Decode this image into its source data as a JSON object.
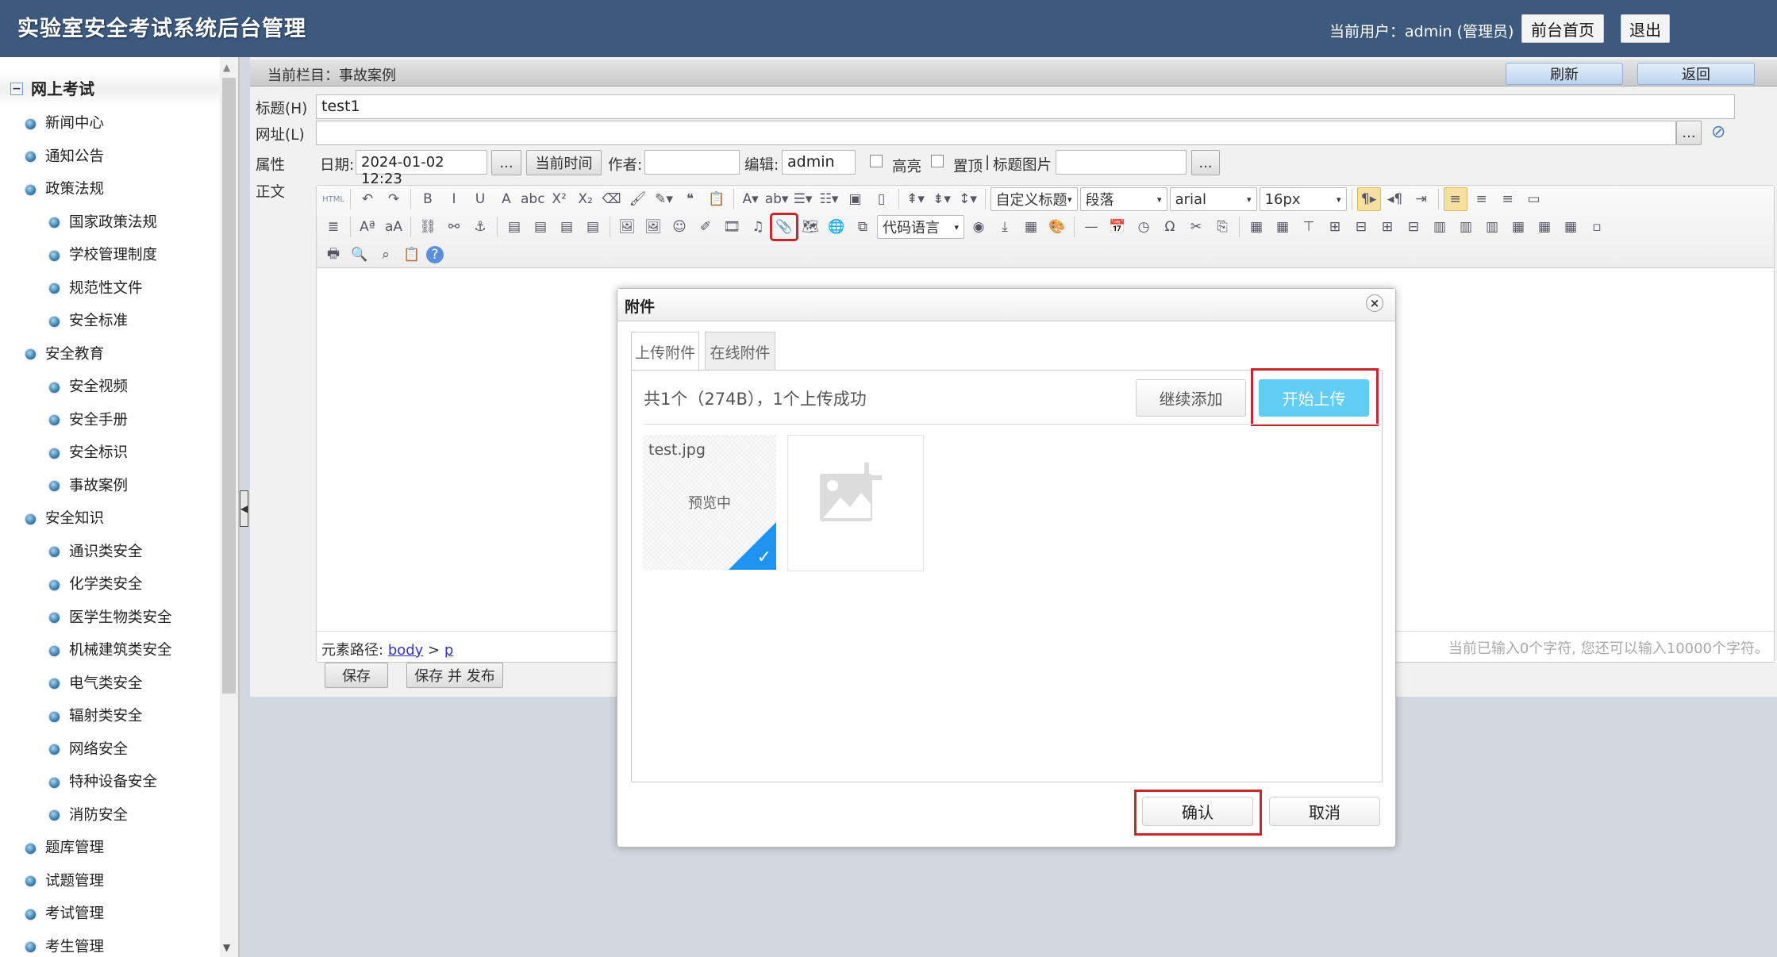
{
  "header": {
    "title": "实验室安全考试系统后台管理",
    "user_info": "当前用户：admin (管理员)",
    "home_btn": "前台首页",
    "logout_btn": "退出",
    "bg_color": "#3d5a7e"
  },
  "sidebar": {
    "header": "网上考试",
    "items": [
      {
        "label": "新闻中心",
        "level": 1
      },
      {
        "label": "通知公告",
        "level": 1
      },
      {
        "label": "政策法规",
        "level": 1
      },
      {
        "label": "国家政策法规",
        "level": 2
      },
      {
        "label": "学校管理制度",
        "level": 2
      },
      {
        "label": "规范性文件",
        "level": 2
      },
      {
        "label": "安全标准",
        "level": 2
      },
      {
        "label": "安全教育",
        "level": 1
      },
      {
        "label": "安全视频",
        "level": 2
      },
      {
        "label": "安全手册",
        "level": 2
      },
      {
        "label": "安全标识",
        "level": 2
      },
      {
        "label": "事故案例",
        "level": 2
      },
      {
        "label": "安全知识",
        "level": 1
      },
      {
        "label": "通识类安全",
        "level": 2
      },
      {
        "label": "化学类安全",
        "level": 2
      },
      {
        "label": "医学生物类安全",
        "level": 2
      },
      {
        "label": "机械建筑类安全",
        "level": 2
      },
      {
        "label": "电气类安全",
        "level": 2
      },
      {
        "label": "辐射类安全",
        "level": 2
      },
      {
        "label": "网络安全",
        "level": 2
      },
      {
        "label": "特种设备安全",
        "level": 2
      },
      {
        "label": "消防安全",
        "level": 2
      },
      {
        "label": "题库管理",
        "level": 1
      },
      {
        "label": "试题管理",
        "level": 1
      },
      {
        "label": "考试管理",
        "level": 1
      },
      {
        "label": "考生管理",
        "level": 1
      }
    ]
  },
  "breadcrumb": {
    "text": "当前栏目：事故案例",
    "refresh": "刷新",
    "back": "返回"
  },
  "form": {
    "title_label": "标题(H)",
    "title_value": "test1",
    "url_label": "网址(L)",
    "url_value": "",
    "browse": "...",
    "attr_label": "属性",
    "date_label": "日期:",
    "date_value": "2024-01-02 12:23",
    "date_btn": "...",
    "now_btn": "当前时间",
    "author_label": "作者:",
    "author_value": "",
    "editor_label": "编辑:",
    "editor_value": "admin",
    "highlight_label": "高亮",
    "top_label": "置顶",
    "sep": "|",
    "title_img_label": "标题图片",
    "title_img_value": "",
    "title_img_btn": "...",
    "body_label": "正文"
  },
  "editor": {
    "row1": [
      {
        "n": "html",
        "g": "HTML"
      },
      {
        "sep": 1
      },
      {
        "n": "undo",
        "g": "↶"
      },
      {
        "n": "redo",
        "g": "↷"
      },
      {
        "sep": 1
      },
      {
        "n": "bold",
        "g": "B"
      },
      {
        "n": "italic",
        "g": "I"
      },
      {
        "n": "underline",
        "g": "U"
      },
      {
        "n": "fontborder",
        "g": "A"
      },
      {
        "n": "strikethrough",
        "g": "abc"
      },
      {
        "n": "superscript",
        "g": "X²"
      },
      {
        "n": "subscript",
        "g": "X₂"
      },
      {
        "n": "eraser",
        "g": "⌫"
      },
      {
        "n": "formatmatch",
        "g": "🖌"
      },
      {
        "n": "autotypeset",
        "g": "✎▾"
      },
      {
        "n": "blockquote",
        "g": "❝"
      },
      {
        "n": "pasteplain",
        "g": "📋"
      },
      {
        "sep": 1
      },
      {
        "n": "forecolor",
        "g": "A▾"
      },
      {
        "n": "backcolor",
        "g": "ab▾"
      },
      {
        "n": "orderedlist",
        "g": "☰▾"
      },
      {
        "n": "unorderedlist",
        "g": "☷▾"
      },
      {
        "n": "selectall",
        "g": "▣"
      },
      {
        "n": "cleardoc",
        "g": "▯"
      },
      {
        "sep": 1
      },
      {
        "n": "rowspacingtop",
        "g": "⇞▾"
      },
      {
        "n": "rowspacingbottom",
        "g": "⇟▾"
      },
      {
        "n": "lineheight",
        "g": "↕▾"
      },
      {
        "sep": 1
      },
      {
        "n": "customstyle",
        "sel": "自定义标题"
      },
      {
        "n": "paragraph",
        "sel": "段落"
      },
      {
        "n": "fontfamily",
        "sel": "arial"
      },
      {
        "n": "fontsize",
        "sel": "16px"
      },
      {
        "sep": 1
      },
      {
        "n": "directionltr",
        "g": "¶▸",
        "hl": 1
      },
      {
        "n": "directionrtl",
        "g": "◂¶"
      },
      {
        "n": "indent",
        "g": "⇥"
      },
      {
        "sep": 1
      },
      {
        "n": "justifyleft",
        "g": "≡",
        "hl": 1
      },
      {
        "n": "justifycenter",
        "g": "≡"
      },
      {
        "n": "justifyright",
        "g": "≡"
      },
      {
        "n": "fullscreen",
        "g": "▭"
      }
    ],
    "row2": [
      {
        "n": "justifyjustify",
        "g": "≣"
      },
      {
        "sep": 1
      },
      {
        "n": "touppercase",
        "g": "Aª"
      },
      {
        "n": "tolowercase",
        "g": "aA"
      },
      {
        "sep": 1
      },
      {
        "n": "link",
        "g": "⛓"
      },
      {
        "n": "unlink",
        "g": "⚯"
      },
      {
        "n": "anchor",
        "g": "⚓"
      },
      {
        "sep": 1
      },
      {
        "n": "imagenone",
        "g": "▤"
      },
      {
        "n": "imageleft",
        "g": "▤"
      },
      {
        "n": "imageright",
        "g": "▤"
      },
      {
        "n": "imagecenter",
        "g": "▤"
      },
      {
        "sep": 1
      },
      {
        "n": "simpleupload",
        "g": "🖼"
      },
      {
        "n": "insertimage",
        "g": "🖼"
      },
      {
        "n": "emotion",
        "g": "☺"
      },
      {
        "n": "scrawl",
        "g": "✐"
      },
      {
        "n": "insertvideo",
        "g": "🎞"
      },
      {
        "n": "music",
        "g": "♫"
      },
      {
        "n": "attachment",
        "g": "📎",
        "red": 1
      },
      {
        "n": "map",
        "g": "🗺"
      },
      {
        "n": "gmap",
        "g": "🌐"
      },
      {
        "n": "insertframe",
        "g": "⧉"
      },
      {
        "n": "insertcode",
        "sel": "代码语言"
      },
      {
        "n": "webapp",
        "g": "◉"
      },
      {
        "n": "pagebreak",
        "g": "⤓"
      },
      {
        "n": "template",
        "g": "▦"
      },
      {
        "n": "background",
        "g": "🎨"
      },
      {
        "sep": 1
      },
      {
        "n": "horizontal",
        "g": "—"
      },
      {
        "n": "date",
        "g": "📅"
      },
      {
        "n": "time",
        "g": "◷"
      },
      {
        "n": "spechars",
        "g": "Ω"
      },
      {
        "n": "snapscreen",
        "g": "✂"
      },
      {
        "n": "wordimage",
        "g": "⎘"
      },
      {
        "sep": 1
      },
      {
        "n": "inserttable",
        "g": "▦"
      },
      {
        "n": "deletetable",
        "g": "▦"
      },
      {
        "n": "paragraphbeforetable",
        "g": "⊤"
      },
      {
        "n": "insertrow",
        "g": "⊞"
      },
      {
        "n": "deleterow",
        "g": "⊟"
      },
      {
        "n": "insertcol",
        "g": "⊞"
      },
      {
        "n": "deletecol",
        "g": "⊟"
      },
      {
        "n": "mergecells",
        "g": "▥"
      },
      {
        "n": "mergeright",
        "g": "▥"
      },
      {
        "n": "mergedown",
        "g": "▥"
      },
      {
        "n": "splittocells",
        "g": "▦"
      },
      {
        "n": "splittorows",
        "g": "▦"
      },
      {
        "n": "splittocols",
        "g": "▦"
      },
      {
        "n": "charts",
        "g": "▫"
      }
    ],
    "row3": [
      {
        "n": "print",
        "g": "🖶"
      },
      {
        "n": "preview",
        "g": "🔍"
      },
      {
        "n": "searchreplace",
        "g": "⌕"
      },
      {
        "n": "drafts",
        "g": "📋"
      },
      {
        "n": "help",
        "g": "?"
      }
    ],
    "path_label": "元素路径:",
    "path_body": "body",
    "path_sep": ">",
    "path_p": "p",
    "word_count": "当前已输入0个字符, 您还可以输入10000个字符。",
    "save": "保存",
    "save_publish": "保存 并 发布"
  },
  "dialog": {
    "title": "附件",
    "close": "×",
    "tabs": [
      "上传附件",
      "在线附件"
    ],
    "info": "共1个（274B），1个上传成功",
    "continue_add": "继续添加",
    "start_upload": "开始上传",
    "file_name": "test.jpg",
    "preview_text": "预览中",
    "confirm": "确认",
    "cancel": "取消",
    "accent_color": "#61cdf4",
    "check_color": "#1e94f0",
    "highlight_color": "#c8282c"
  }
}
